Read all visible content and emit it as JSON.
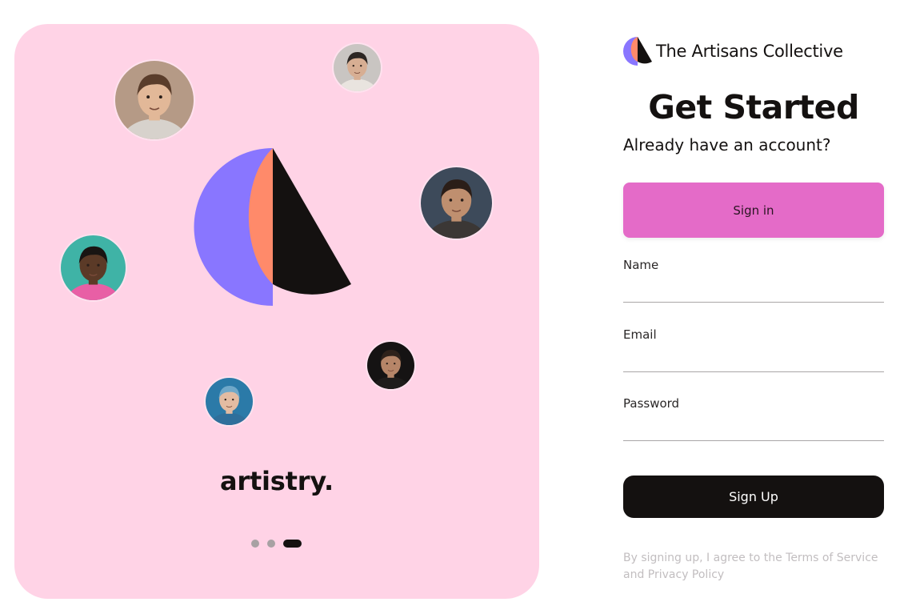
{
  "hero": {
    "tagline": "artistry.",
    "carousel": {
      "count": 3,
      "active_index": 2
    }
  },
  "avatars": [
    {
      "name": "avatar-top-left",
      "skin": "#e2b898",
      "hair": "#5a3d2b",
      "shirt": "#d7d2cc",
      "bg": "#b59a86"
    },
    {
      "name": "avatar-top-right",
      "skin": "#d7ae93",
      "hair": "#2c2623",
      "shirt": "#e9e4df",
      "bg": "#c9c5c2"
    },
    {
      "name": "avatar-right",
      "skin": "#bf8f6f",
      "hair": "#2b1e18",
      "shirt": "#3b3735",
      "bg": "#3d4a5a"
    },
    {
      "name": "avatar-left",
      "skin": "#5b3a27",
      "hair": "#191513",
      "shirt": "#e85fa5",
      "bg": "#3fb3a6"
    },
    {
      "name": "avatar-middle-right",
      "skin": "#b68568",
      "hair": "#2f221b",
      "shirt": "#1f1c1b",
      "bg": "#151313"
    },
    {
      "name": "avatar-bottom",
      "skin": "#e4bca2",
      "hair": "#6fa8c9",
      "shirt": "#2f6f9b",
      "bg": "#2b7aa8"
    }
  ],
  "brand": {
    "name": "The Artisans Collective",
    "colors": {
      "purple": "#8976ff",
      "orange": "#ff8a6a",
      "black": "#141110"
    }
  },
  "form": {
    "title": "Get Started",
    "subtitle": "Already have an account?",
    "signin_label": "Sign in",
    "fields": [
      {
        "label": "Name",
        "value": ""
      },
      {
        "label": "Email",
        "value": ""
      },
      {
        "label": "Password",
        "value": ""
      }
    ],
    "signup_label": "Sign Up",
    "terms": "By signing up, I agree to the Terms of Service and Privacy Policy"
  },
  "colors": {
    "hero_bg": "#ffd3e6",
    "signin_bg": "#e46bc8",
    "signup_bg": "#141110",
    "muted_text": "#c2bec0"
  }
}
